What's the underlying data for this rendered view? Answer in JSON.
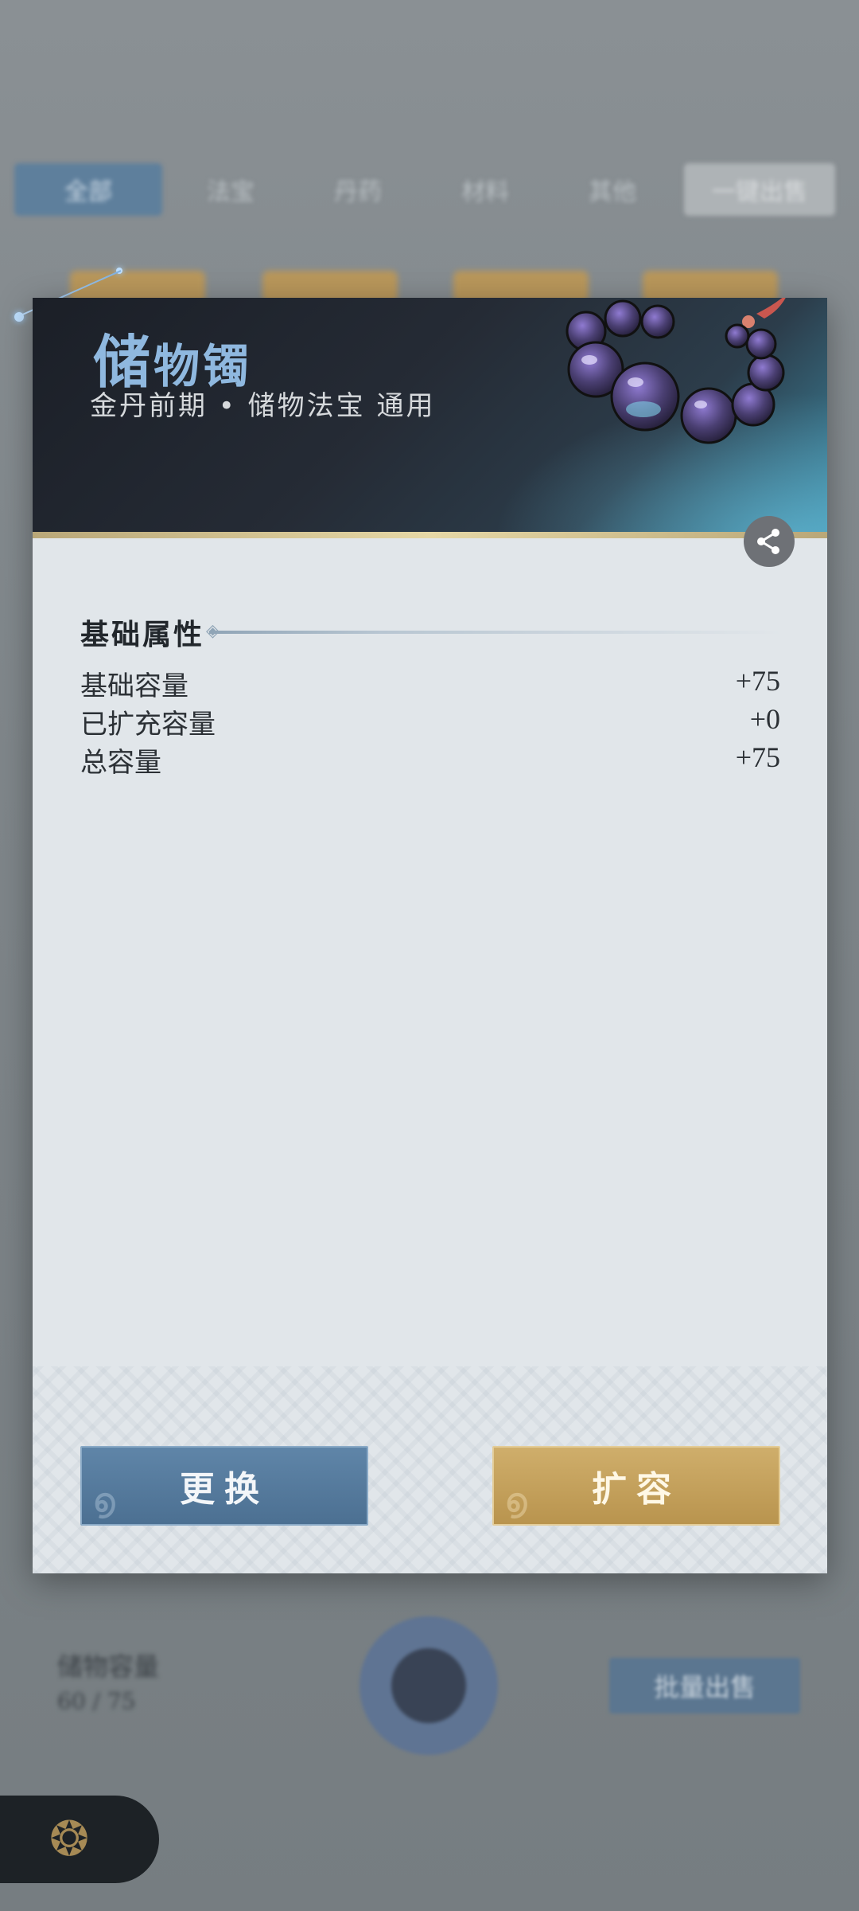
{
  "background": {
    "tabs": [
      "全部",
      "法宝",
      "丹药",
      "材料",
      "其他",
      "一键出售"
    ],
    "bottom_left_text": "储物容量",
    "bottom_left_sub": "60 / 75",
    "bottom_right_button": "批量出售"
  },
  "item": {
    "name_first": "储",
    "name_rest": "物镯",
    "subtitle": "金丹前期 • 储物法宝 通用"
  },
  "section": {
    "title": "基础属性"
  },
  "stats": [
    {
      "label": "基础容量",
      "value": "+75"
    },
    {
      "label": "已扩充容量",
      "value": "+0"
    },
    {
      "label": "总容量",
      "value": "+75"
    }
  ],
  "buttons": {
    "swap": "更换",
    "expand": "扩容"
  },
  "icons": {
    "share": "share-icon",
    "back": "back-emblem-icon"
  },
  "colors": {
    "title": "#8fb8df",
    "swap_button": "#4c7092",
    "expand_button": "#b9944e"
  }
}
